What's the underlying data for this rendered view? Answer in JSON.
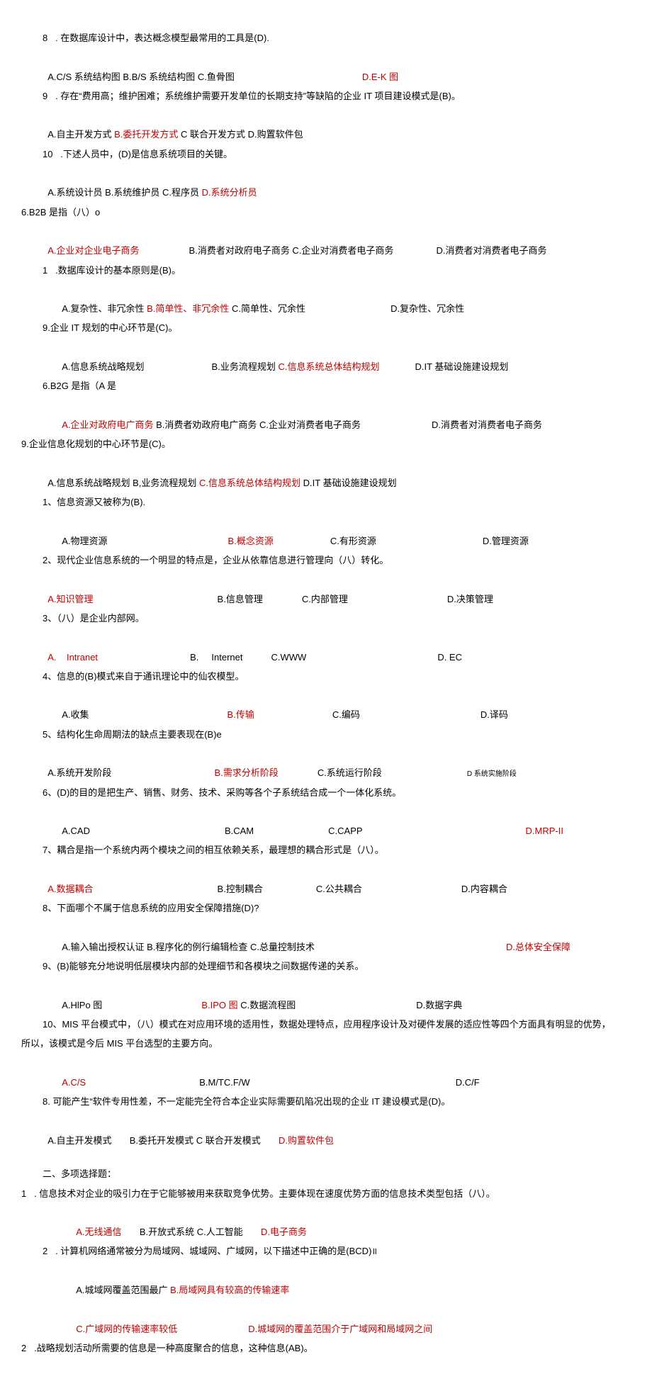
{
  "q8": {
    "stem": "8   . 在数据库设计中，表达概念模型最常用的工具是(D).",
    "a": "A.C/S 系统结构图 B.B/S 系统结构图 C.鱼骨图",
    "d": "D.E-K 图"
  },
  "q9a": {
    "stem": "9   . 存在“费用高；维护困难；系统维护需要开发单位的长期支持”等缺陷的企业 IT 项目建设模式是(B)。",
    "a": "A.自主开发方式 ",
    "b": "B.委托开发方式",
    "cd": " C 联合开发方式 D.购置软件包"
  },
  "q10": {
    "stem": "10   .下述人员中，(D)是信息系统项目的关键。",
    "abc": "A.系统设计员 B.系统维护员 C.程序员 ",
    "d": "D.系统分析员"
  },
  "q6b2b": {
    "stem": "6.B2B 是指（八）o",
    "a": "A.企业对企业电子商务",
    "bc": "B.消费者对政府电子商务 C.企业对消费者电子商务",
    "d": "D.消费者对消费者电子商务"
  },
  "q1db": {
    "stem": "1   .数据库设计的基本原则是(B)。",
    "a": "A.复杂性、非冗余性 ",
    "b": "B.简单性、非冗余性",
    "c": " C.简单性、冗余性",
    "d": "D.复杂性、冗余性"
  },
  "q9it": {
    "stem": "9.企业 IT 规划的中心环节是(C)。",
    "a": "A.信息系统战略规划",
    "b": "B.业务流程规划 ",
    "c": "C.信息系统总体结构规划",
    "d": "D.IT 基础设施建设规划"
  },
  "q6b2g": {
    "stem": "6.B2G 是指（A 是",
    "a": "A.企业对政府电广商务",
    "bc": " B.消费者劝政府电广商务 C.企业对消费者电子商务",
    "d": "D.消费者对消费者电子商务"
  },
  "q9ent": {
    "stem": "9.企业信息化规划的中心环节是(C)。",
    "ab": "A.信息系统战略规划 B,业务流程规划 ",
    "c": "C.信息系统总体结构规划",
    "d": " D.IT 基础设施建设规划"
  },
  "q1info": {
    "stem": "1、信息资源又被称为(B).",
    "a": "A.物理资源",
    "b": "B.概念资源",
    "c": "C.有形资源",
    "d": "D.管理资源"
  },
  "q2mod": {
    "stem": "2、现代企业信息系统的一个明显的特点是，企业从依靠信息进行管理向（八）转化。",
    "a": "A.知识管理",
    "b": "B.信息管理",
    "c": "C.内部管理",
    "d": "D.决策管理"
  },
  "q3intra": {
    "stem": "3、（八）是企业内部网。",
    "a": "A.    Intranet",
    "b": "B.     Internet",
    "c": "C.WWW",
    "d": "D. EC"
  },
  "q4sh": {
    "stem": "4、信息的(B)模式来自于通讯理论中的仙农模型。",
    "a": "A.收集",
    "b": "B.传输",
    "c": "C.编码",
    "d": "D.译码"
  },
  "q5life": {
    "stem": "5、结构化生命周期法的缺点主要表现在(B)e",
    "a": "A.系统开发阶段",
    "b": "B.需求分析阶段",
    "c": "C.系统运行阶段",
    "d": "D 系统实施阶段"
  },
  "q6d": {
    "stem": "6、(D)的目的是把生产、销售、财务、技术、采购等各个子系统结合成一个一体化系统。",
    "a": "A.CAD",
    "b": "B.CAM",
    "c": "C.CAPP",
    "d": "D.MRP-II"
  },
  "q7coup": {
    "stem": "7、耦合是指一个系统内两个模块之间的相互依赖关系，最理想的耦合形式是（八）。",
    "a": "A.数据耦合",
    "b": "B.控制耦合",
    "c": "C.公共耦合",
    "d": "D.内容耦合"
  },
  "q8sec": {
    "stem": "8、下面哪个不属于信息系统的应用安全保障措施(D)?",
    "abc": "A.输入输出授权认证 B.程序化的例行编辑检查 C.总量控制技术",
    "d": "D.总体安全保障"
  },
  "q9ipo": {
    "stem": "9、(B)能够充分地说明低层模块内部的处理细节和各模块之间数据传递的关系。",
    "a": "A.HlPo 图",
    "b": "B.IPO 图",
    "c": " C.数据流程图",
    "d": "D.数据字典"
  },
  "q10mis": {
    "stem1": "10、MIS 平台模式中，（八）模式在对应用环境的适用性，数据处理特点，应用程序设计及对硬件发展的适应性等四个方面具有明显的优势，",
    "stem2": "所以，该模式是今后 MIS 平台选型的主要方向。",
    "a": "A.C/S",
    "b": "B.M/TC.F/W",
    "d": "D.C/F"
  },
  "q8soft": {
    "stem": "8. 可能产生“软件专用性差，不一定能完全符合本企业实际需要矶陷况出现的企业 IT 建设模式是(D)。",
    "a": "A.自主开发模式       B.委托开发模式 C 联合开发模式       ",
    "d": "D.购置软件包"
  },
  "section2": "二、多项选择题：",
  "m1": {
    "stem": "1   . 信息技术对企业的吸引力在于它能够被用来获取竞争优势。主要体现在速度优势方面的信息技术类型包括（八）。",
    "a": "A.无线通信",
    "bc": "       B.开放式系统 C.人工智能       ",
    "d": "D.电子商务"
  },
  "m2": {
    "stem": "2   . 计算机网络通常被分为局域网、城域网、广域网，以下描述中正确的是(BCD)॥",
    "a": "A.城域网覆盖范围最广 ",
    "b": "B.局域网具有较高的传输速率",
    "c": "C.广域网的传输速率较低",
    "d": "D.城域网的覆盖范围介于广域网和局域网之间"
  },
  "m2b": {
    "stem": "2   .战略规划活动所需要的信息是一种高度聚合的信息，这种信息(AB)。"
  }
}
